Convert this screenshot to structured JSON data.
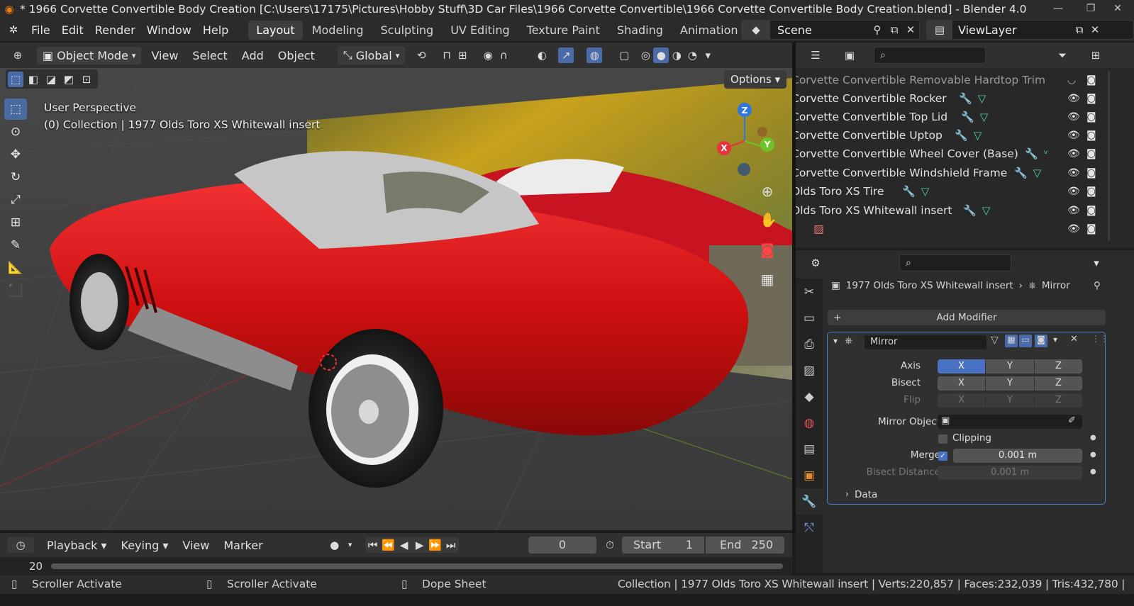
{
  "title": "* 1966 Corvette Convertible Body Creation [C:\\Users\\17175\\Pictures\\Hobby Stuff\\3D Car Files\\1966 Corvette Convertible\\1966 Corvette Convertible Body Creation.blend] - Blender 4.0",
  "window_controls": {
    "minimize": "—",
    "maximize": "❐",
    "close": "✕"
  },
  "menu": [
    "File",
    "Edit",
    "Render",
    "Window",
    "Help"
  ],
  "workspaces": [
    {
      "label": "Layout",
      "active": true
    },
    {
      "label": "Modeling",
      "active": false
    },
    {
      "label": "Sculpting",
      "active": false
    },
    {
      "label": "UV Editing",
      "active": false
    },
    {
      "label": "Texture Paint",
      "active": false
    },
    {
      "label": "Shading",
      "active": false
    },
    {
      "label": "Animation",
      "active": false
    }
  ],
  "scene": {
    "name": "Scene",
    "view_layer": "ViewLayer"
  },
  "viewport_header": {
    "mode": "Object Mode",
    "menus": [
      "View",
      "Select",
      "Add",
      "Object"
    ],
    "orientation": "Global",
    "options": "Options"
  },
  "viewport": {
    "perspective": "User Perspective",
    "collection_info": "(0) Collection | 1977 Olds Toro XS Whitewall insert",
    "gizmo": {
      "x": "X",
      "y": "Y",
      "z": "Z"
    }
  },
  "outliner": {
    "rows": [
      {
        "name": "Corvette Convertible Removable Hardtop Trim",
        "tags": []
      },
      {
        "name": "Corvette Convertible Rocker",
        "tags": [
          "wrench",
          "mesh"
        ]
      },
      {
        "name": "Corvette Convertible Top Lid",
        "tags": [
          "wrench",
          "mesh"
        ]
      },
      {
        "name": "Corvette Convertible Uptop",
        "tags": [
          "wrench",
          "mesh"
        ]
      },
      {
        "name": "Corvette Convertible Wheel Cover (Base)",
        "tags": [
          "wrench",
          "mesh"
        ]
      },
      {
        "name": "Corvette Convertible Windshield Frame",
        "tags": [
          "wrench",
          "mesh"
        ]
      },
      {
        "name": "Olds Toro XS Tire",
        "tags": [
          "wrench",
          "mesh"
        ]
      },
      {
        "name": "Olds Toro XS Whitewall insert",
        "tags": [
          "wrench",
          "mesh"
        ]
      },
      {
        "name": "",
        "tags": [
          "image"
        ]
      }
    ]
  },
  "properties": {
    "object_name": "1977 Olds Toro XS Whitewall insert",
    "breadcrumb_modifier": "Mirror",
    "add_modifier": "Add Modifier",
    "modifier": {
      "name": "Mirror",
      "axis_label": "Axis",
      "bisect_label": "Bisect",
      "flip_label": "Flip",
      "axes": [
        "X",
        "Y",
        "Z"
      ],
      "axis_enabled": {
        "X": true,
        "Y": false,
        "Z": false
      },
      "mirror_object_label": "Mirror Object",
      "clipping_label": "Clipping",
      "clipping": false,
      "merge_label": "Merge",
      "merge_checked": true,
      "merge_value": "0.001 m",
      "bisect_distance_label": "Bisect Distance",
      "bisect_distance_value": "0.001 m",
      "data_label": "Data"
    }
  },
  "timeline": {
    "menus": [
      "Playback",
      "Keying",
      "View",
      "Marker"
    ],
    "current_frame": "0",
    "start_label": "Start",
    "start": "1",
    "end_label": "End",
    "end": "250",
    "scrub_start": "20"
  },
  "status_bar": {
    "left1": "Scroller Activate",
    "left2": "Scroller Activate",
    "left3": "Dope Sheet",
    "stats": "Collection | 1977 Olds Toro XS Whitewall insert | Verts:220,857 | Faces:232,039 | Tris:432,780 |"
  },
  "colors": {
    "accent": "#4a72c4",
    "selected": "#4b6aa8",
    "body_red": "#d41313",
    "axis_x": "#e6333f",
    "axis_y": "#6ec429",
    "axis_z": "#2f77e0"
  }
}
